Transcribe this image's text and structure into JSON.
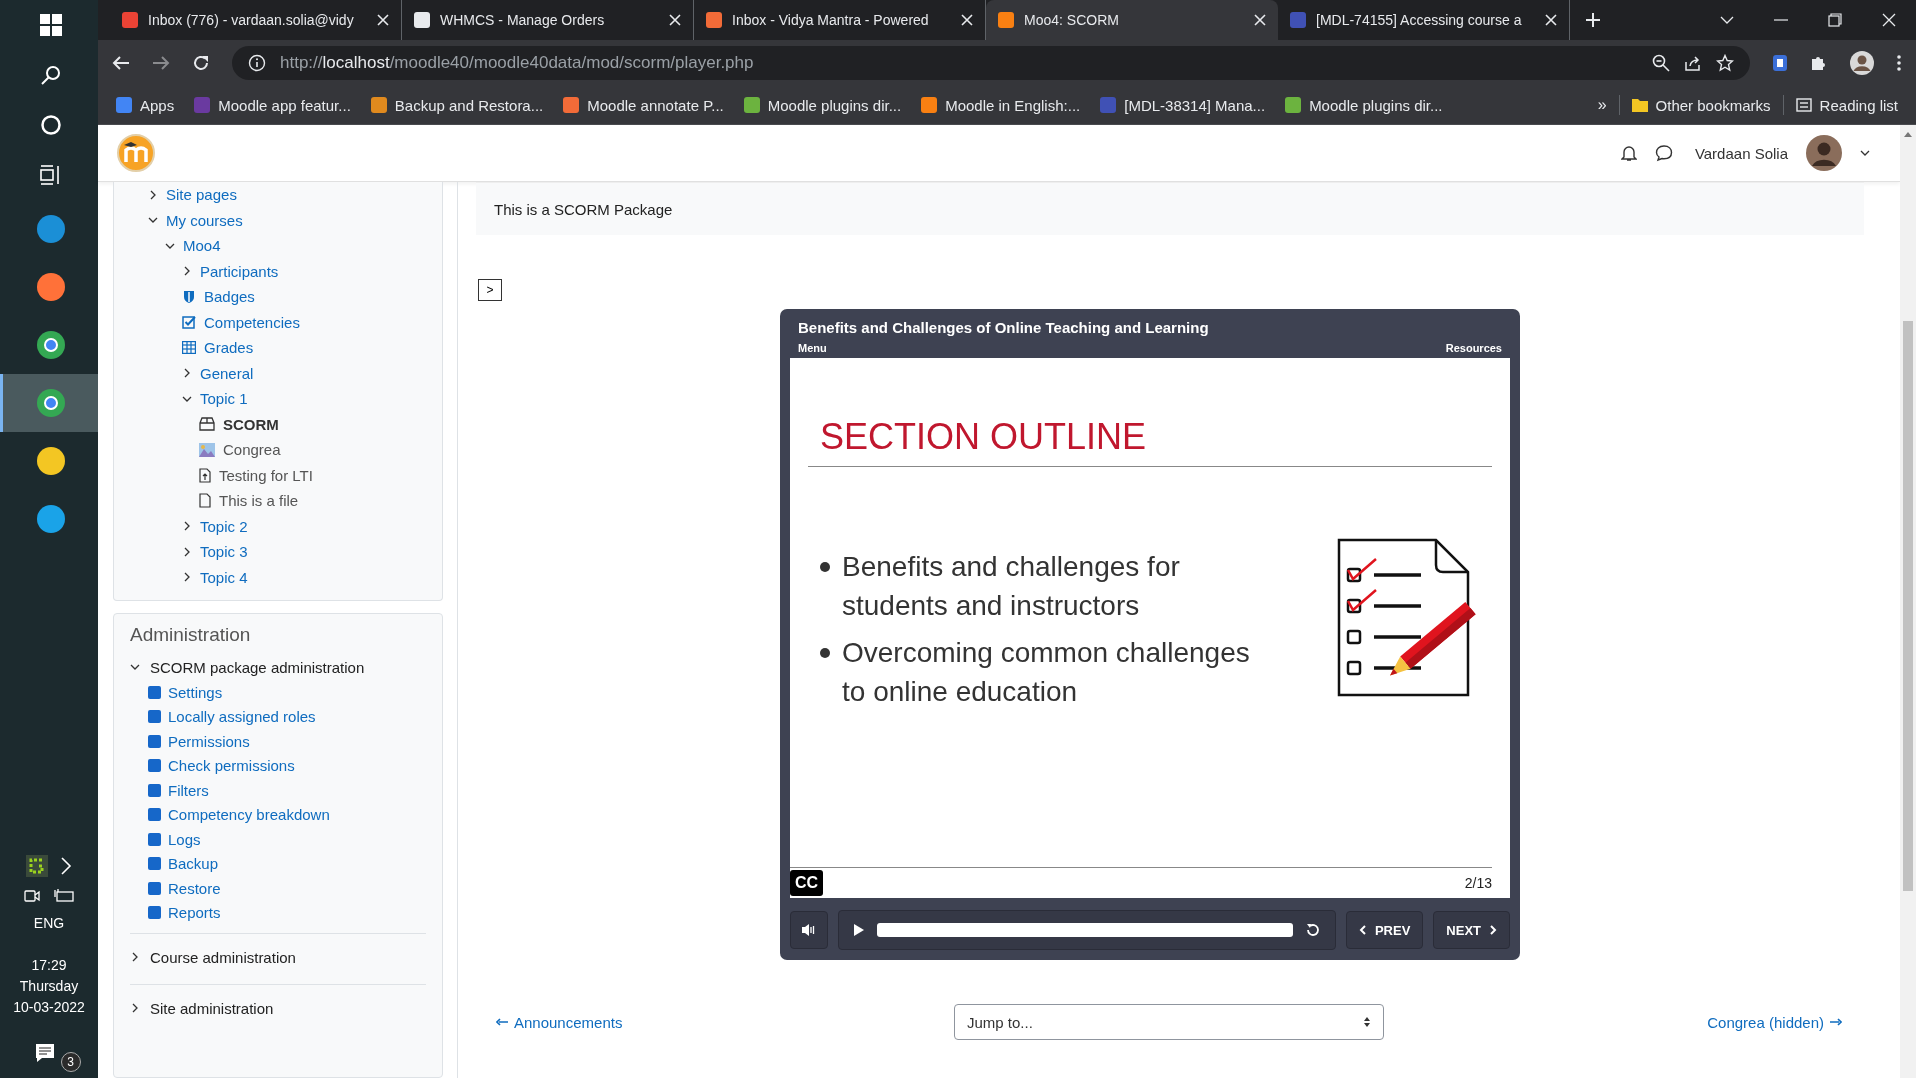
{
  "taskbar": {
    "apps": [
      {
        "kind": "start",
        "selected": false
      },
      {
        "kind": "search",
        "selected": false
      },
      {
        "kind": "cortana",
        "selected": false
      },
      {
        "kind": "taskview",
        "selected": false
      },
      {
        "kind": "edge",
        "selected": false
      },
      {
        "kind": "firefox",
        "selected": false
      },
      {
        "kind": "chrome",
        "selected": false
      },
      {
        "kind": "chrome-profile",
        "selected": true
      },
      {
        "kind": "explorer",
        "selected": false
      },
      {
        "kind": "elephant",
        "selected": false
      }
    ],
    "tray": {
      "language": "ENG",
      "time": "17:29",
      "day": "Thursday",
      "date": "10-03-2022",
      "notification_count": "3"
    }
  },
  "browser": {
    "tabs": [
      {
        "title": "Inbox (776) - vardaan.solia@vidy",
        "color": "#ea4335",
        "selected": false
      },
      {
        "title": "WHMCS - Manage Orders",
        "color": "#e8eaed",
        "selected": false
      },
      {
        "title": "Inbox - Vidya Mantra - Powered",
        "color": "#f26b38",
        "selected": false
      },
      {
        "title": "Moo4: SCORM",
        "color": "#f98012",
        "selected": true
      },
      {
        "title": "[MDL-74155] Accessing course a",
        "color": "#4051b5",
        "selected": false
      }
    ],
    "url": {
      "scheme": "http://",
      "host": "localhost",
      "path": "/moodle40/moodle40data/mod/scorm/player.php"
    },
    "bookmarks": [
      {
        "label": "Apps",
        "color": "#4285f4"
      },
      {
        "label": "Moodle app featur...",
        "color": "#6a3aa0"
      },
      {
        "label": "Backup and Restora...",
        "color": "#e08a1e"
      },
      {
        "label": "Moodle annotate P...",
        "color": "#f26b38"
      },
      {
        "label": "Moodle plugins dir...",
        "color": "#6cb33f"
      },
      {
        "label": "Moodle in English:...",
        "color": "#f98012"
      },
      {
        "label": "[MDL-38314] Mana...",
        "color": "#4051b5"
      },
      {
        "label": "Moodle plugins dir...",
        "color": "#6cb33f"
      }
    ],
    "overflow": "»",
    "other_bookmarks": "Other bookmarks",
    "reading_list": "Reading list"
  },
  "header": {
    "user": "Vardaan Solia"
  },
  "navigation": {
    "items": [
      {
        "label": "Site pages",
        "kind": "branch",
        "expanded": false
      },
      {
        "label": "My courses",
        "kind": "branch",
        "expanded": true,
        "children": [
          {
            "label": "Moo4",
            "kind": "branch",
            "expanded": true,
            "children": [
              {
                "label": "Participants",
                "kind": "branch",
                "expanded": false
              },
              {
                "label": "Badges",
                "kind": "badge"
              },
              {
                "label": "Competencies",
                "kind": "competency"
              },
              {
                "label": "Grades",
                "kind": "grades"
              },
              {
                "label": "General",
                "kind": "branch",
                "expanded": false
              },
              {
                "label": "Topic 1",
                "kind": "branch",
                "expanded": true,
                "children": [
                  {
                    "label": "SCORM",
                    "kind": "scorm",
                    "selected": true
                  },
                  {
                    "label": "Congrea",
                    "kind": "congrea",
                    "selected": false
                  },
                  {
                    "label": "Testing for LTI",
                    "kind": "lti",
                    "selected": false
                  },
                  {
                    "label": "This is a file",
                    "kind": "file",
                    "selected": false
                  }
                ]
              },
              {
                "label": "Topic 2",
                "kind": "branch",
                "expanded": false
              },
              {
                "label": "Topic 3",
                "kind": "branch",
                "expanded": false
              },
              {
                "label": "Topic 4",
                "kind": "branch",
                "expanded": false
              }
            ]
          }
        ]
      }
    ]
  },
  "administration": {
    "title": "Administration",
    "sections": [
      {
        "label": "SCORM package administration",
        "expanded": true,
        "items": [
          "Settings",
          "Locally assigned roles",
          "Permissions",
          "Check permissions",
          "Filters",
          "Competency breakdown",
          "Logs",
          "Backup",
          "Restore",
          "Reports"
        ]
      },
      {
        "label": "Course administration",
        "expanded": false
      },
      {
        "label": "Site administration",
        "expanded": false
      }
    ]
  },
  "content": {
    "intro": "This is a SCORM Package",
    "toc_toggle": ">",
    "player": {
      "title": "Benefits and Challenges of Online Teaching and Learning",
      "menu": "Menu",
      "resources": "Resources",
      "slide": {
        "heading": "SECTION OUTLINE",
        "bullets": [
          "Benefits and challenges for students and instructors",
          "Overcoming common challenges to online education"
        ]
      },
      "captions": "CC",
      "slide_counter": "2/13",
      "prev": "PREV",
      "next": "NEXT"
    },
    "footer": {
      "previous_link": "Announcements",
      "jump_label": "Jump to...",
      "next_link": "Congrea (hidden)"
    }
  }
}
